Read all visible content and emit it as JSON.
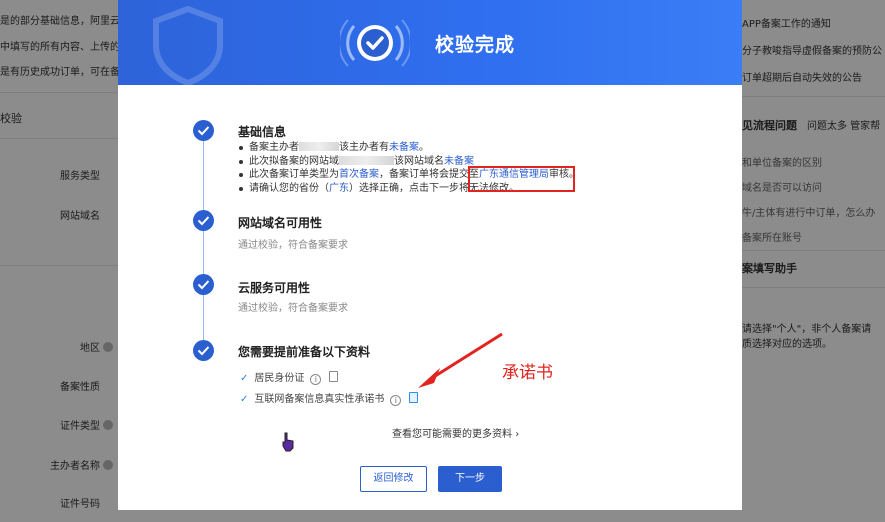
{
  "background": {
    "left_texts": [
      "是的部分基础信息，阿里云会",
      "中填写的所有内容、上传的",
      "是有历史成功订单，可在备案"
    ],
    "left_section": "校验",
    "form_labels": [
      "服务类型",
      "网站域名",
      "地区",
      "备案性质",
      "证件类型",
      "主办者名称",
      "证件号码"
    ],
    "right_notices": [
      "APP备案工作的通知",
      "分子教唆指导虚假备案的预防公",
      "订单超期后自动失效的公告"
    ],
    "right_section_title": "见流程问题",
    "right_section_extra": "问题太多 管家帮",
    "right_faq": [
      "和单位备案的区别",
      "域名是否可以访问",
      "牛/主体有进行中订单，怎么办",
      "备案所在账号"
    ],
    "right_helper_title": "案填写助手",
    "right_helper_lines": [
      "请选择\"个人\"，非个人备案请",
      "质选择对应的选项。"
    ]
  },
  "modal": {
    "title": "校验完成",
    "steps": [
      {
        "title": "基础信息",
        "bullets": [
          [
            "备案主办者",
            "该主办者有",
            "未备案",
            "。"
          ],
          [
            "此次拟备案的网站域",
            "该网站域名",
            "未备案",
            ""
          ],
          [
            "此次备案订单类型为",
            "首次备案",
            "，备案订单将会提交至",
            "广东通信管理局",
            "审核。"
          ],
          [
            "请确认您的省份（",
            "广东",
            "）选择正确，点击下一步将无法修改。"
          ]
        ]
      },
      {
        "title": "网站域名可用性",
        "desc": "通过校验，符合备案要求"
      },
      {
        "title": "云服务可用性",
        "desc": "通过校验，符合备案要求"
      },
      {
        "title": "您需要提前准备以下资料"
      }
    ],
    "documents": [
      "居民身份证",
      "互联网备案信息真实性承诺书"
    ],
    "more_link": "查看您可能需要的更多资料",
    "back_button": "返回修改",
    "next_button": "下一步"
  },
  "annotation_text": "承诺书",
  "colors": {
    "primary": "#2b5fd0",
    "annotation": "#e0241f"
  }
}
